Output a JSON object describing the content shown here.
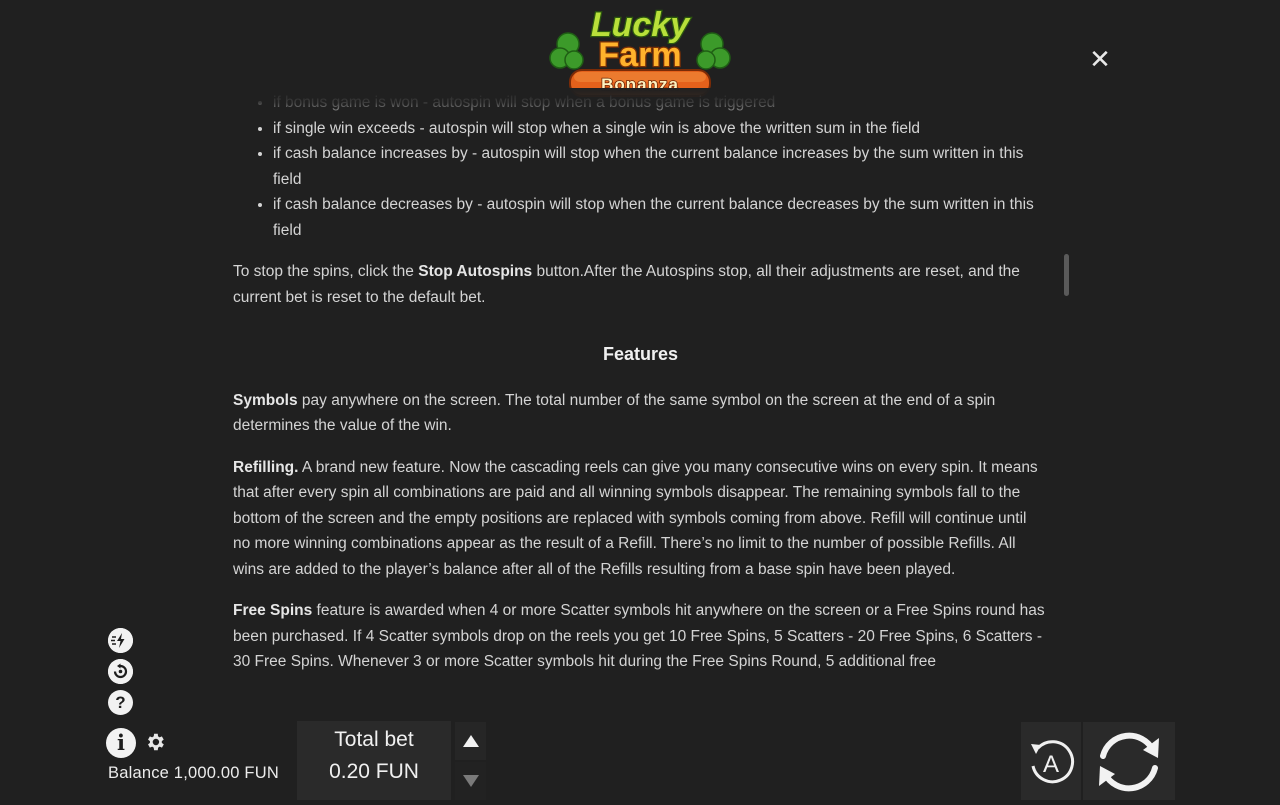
{
  "logo": {
    "line1": "Lucky",
    "line2": "Farm",
    "line3": "Bonanza"
  },
  "close_label": "✕",
  "rules": {
    "bullets": [
      "if bonus game is won - autospin will stop when a bonus game is triggered",
      "if single win exceeds - autospin will stop when a single win is above the written sum in the field",
      "if cash balance increases by - autospin will stop when the current balance increases by the sum written in this field",
      "if cash balance decreases by - autospin will stop when the current balance decreases by the sum written in this field"
    ],
    "stop_para": {
      "pre": "To stop the spins, click the ",
      "bold": "Stop Autospins",
      "post": " button.After the Autospins stop, all their adjustments are reset, and the current bet is reset to the default bet."
    },
    "features_heading": "Features",
    "symbols_para": {
      "bold": "Symbols",
      "text": " pay anywhere on the screen. The total number of the same symbol on the screen at the end of a spin determines the value of the win."
    },
    "refilling_para": {
      "bold": "Refilling.",
      "text": " A brand new feature. Now the cascading reels can give you many consecutive wins on every spin. It means that after every spin all combinations are paid and all winning symbols disappear. The remaining symbols fall to the bottom of the screen and the empty positions are replaced with symbols coming from above. Refill will continue until no more winning combinations appear as the result of a Refill. There’s no limit to the number of possible Refills. All wins are added to the player’s balance after all of the Refills resulting from a base spin have been played."
    },
    "freespins_para": {
      "bold": "Free Spins",
      "text": " feature is awarded when 4 or more Scatter symbols hit anywhere on the screen or a Free Spins round has been purchased. If 4 Scatter symbols drop on the reels you get 10 Free Spins, 5 Scatters - 20 Free Spins, 6 Scatters - 30 Free Spins. Whenever 3 or more Scatter symbols hit during the Free Spins Round, 5 additional free"
    }
  },
  "side_icons": {
    "turbo_icon": "turbo-spin-icon",
    "history_icon": "history-icon",
    "help_label": "?",
    "info_label": "i",
    "gear_icon": "gear-icon"
  },
  "balance_text": "Balance 1,000.00 FUN",
  "bet": {
    "label": "Total bet",
    "value": "0.20 FUN"
  },
  "auto_label": "A",
  "colors": {
    "background": "#202020",
    "panel": "#2a2a2a",
    "text": "#d4d4d4"
  }
}
